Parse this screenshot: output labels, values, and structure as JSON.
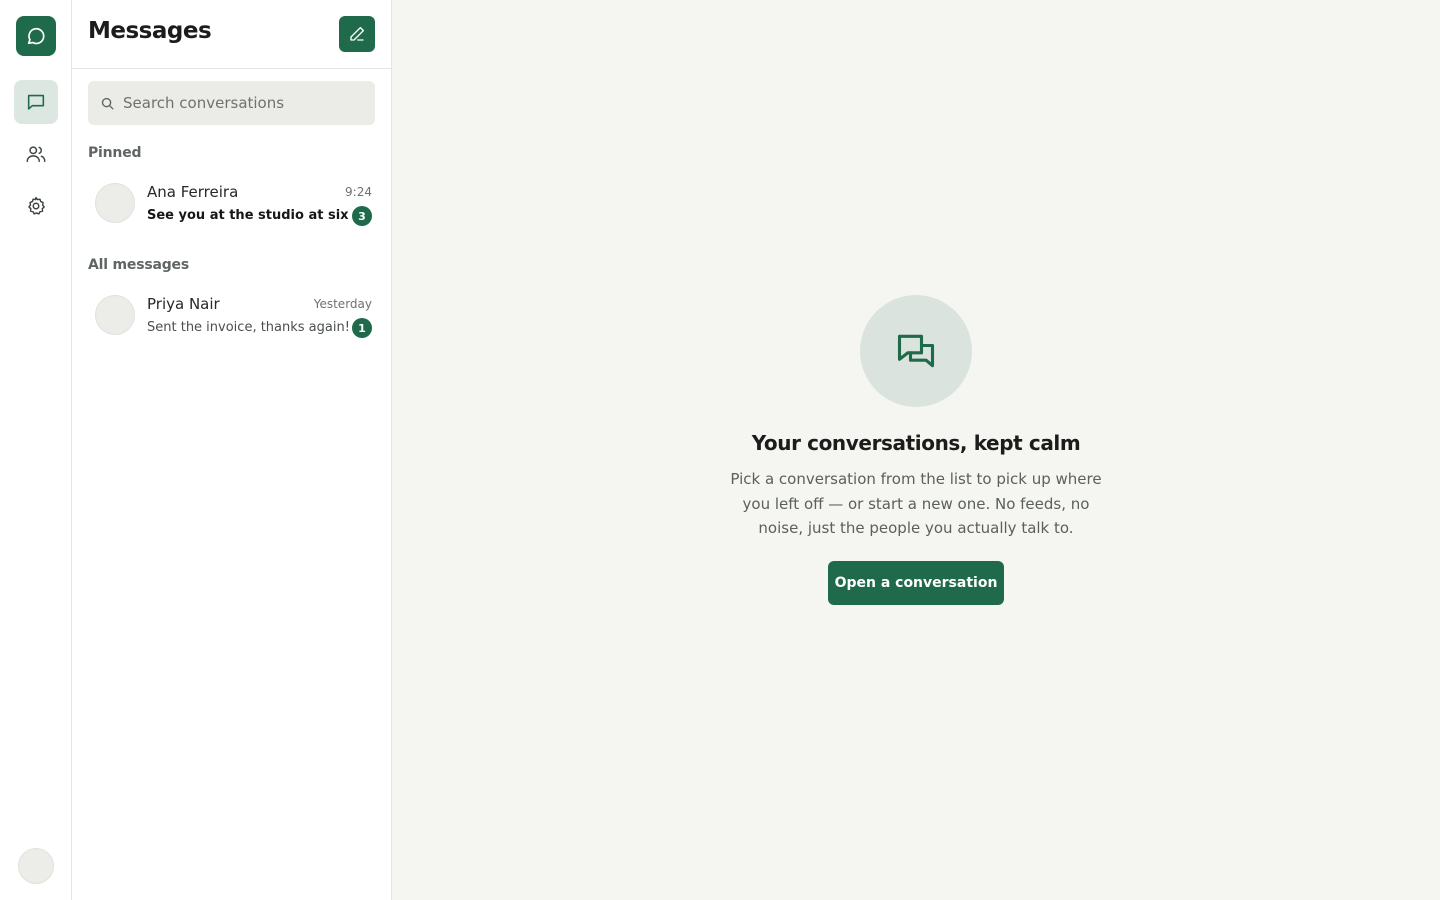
{
  "rail": {
    "logo_icon": "chat-bubble-icon",
    "nav": [
      {
        "icon": "messages-icon",
        "active": true
      },
      {
        "icon": "contacts-icon",
        "active": false
      },
      {
        "icon": "settings-icon",
        "active": false
      }
    ]
  },
  "list": {
    "title": "Messages",
    "compose_icon": "pencil-icon",
    "search_placeholder": "Search conversations",
    "sections": {
      "pinned": "Pinned",
      "all": "All messages"
    },
    "conversations": [
      {
        "name": "Ana Ferreira",
        "time": "9:24",
        "preview": "See you at the studio at six 👋",
        "unread": 3
      },
      {
        "name": "Priya Nair",
        "time": "Yesterday",
        "preview": "Sent the invoice, thanks again!",
        "unread": 1
      }
    ]
  },
  "empty": {
    "icon": "conversations-icon",
    "title": "Your conversations, kept calm",
    "text": "Pick a conversation from the list to pick up where you left off — or start a new one. No feeds, no noise, just the people you actually talk to.",
    "button": "Open a conversation"
  },
  "colors": {
    "accent": "#1f6a4a",
    "page_bg": "#f5f6f1",
    "panel_bg": "#ffffff"
  }
}
